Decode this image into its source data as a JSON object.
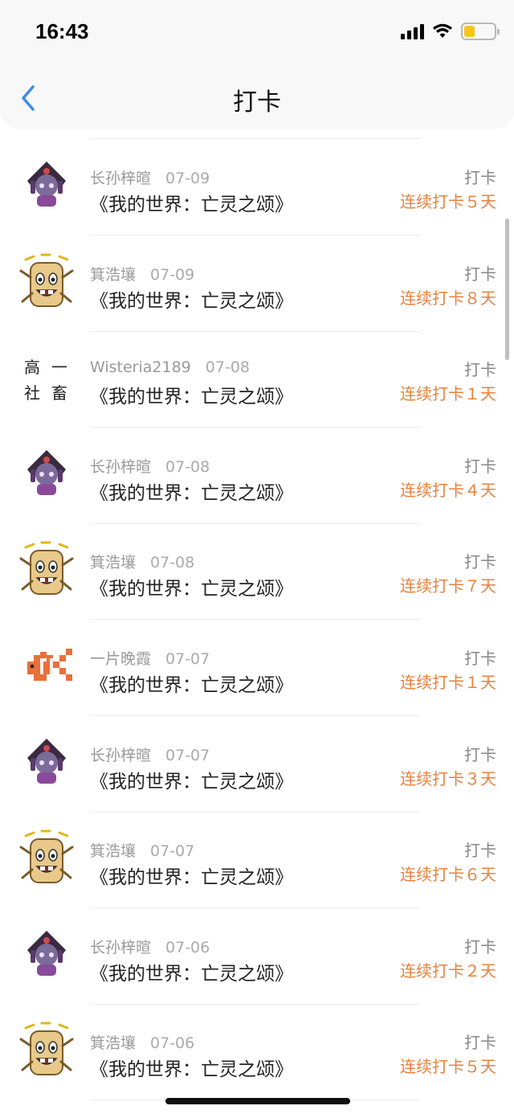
{
  "status_bar": {
    "time": "16:43",
    "battery_color": "#f5c518",
    "battery_level": 0.35
  },
  "nav": {
    "title": "打卡",
    "back_icon": "chevron-left-icon",
    "accent": "#3a8ee6"
  },
  "checkins": [
    {
      "user": "长孙梓暄",
      "date": "07-09",
      "game": "《我的世界：亡灵之颂》",
      "type": "打卡",
      "streak": "连续打卡５天",
      "avatar": "dark-hood"
    },
    {
      "user": "箕浩壤",
      "date": "07-09",
      "game": "《我的世界：亡灵之颂》",
      "type": "打卡",
      "streak": "连续打卡８天",
      "avatar": "bread"
    },
    {
      "user": "Wisteria2189",
      "date": "07-08",
      "game": "《我的世界：亡灵之颂》",
      "type": "打卡",
      "streak": "连续打卡１天",
      "avatar": "text",
      "avatar_text": [
        "高",
        "一",
        "社",
        "畜"
      ]
    },
    {
      "user": "长孙梓暄",
      "date": "07-08",
      "game": "《我的世界：亡灵之颂》",
      "type": "打卡",
      "streak": "连续打卡４天",
      "avatar": "dark-hood"
    },
    {
      "user": "箕浩壤",
      "date": "07-08",
      "game": "《我的世界：亡灵之颂》",
      "type": "打卡",
      "streak": "连续打卡７天",
      "avatar": "bread"
    },
    {
      "user": "一片晚霞",
      "date": "07-07",
      "game": "《我的世界：亡灵之颂》",
      "type": "打卡",
      "streak": "连续打卡１天",
      "avatar": "fish"
    },
    {
      "user": "长孙梓暄",
      "date": "07-07",
      "game": "《我的世界：亡灵之颂》",
      "type": "打卡",
      "streak": "连续打卡３天",
      "avatar": "dark-hood"
    },
    {
      "user": "箕浩壤",
      "date": "07-07",
      "game": "《我的世界：亡灵之颂》",
      "type": "打卡",
      "streak": "连续打卡６天",
      "avatar": "bread"
    },
    {
      "user": "长孙梓暄",
      "date": "07-06",
      "game": "《我的世界：亡灵之颂》",
      "type": "打卡",
      "streak": "连续打卡２天",
      "avatar": "dark-hood"
    },
    {
      "user": "箕浩壤",
      "date": "07-06",
      "game": "《我的世界：亡灵之颂》",
      "type": "打卡",
      "streak": "连续打卡５天",
      "avatar": "bread"
    }
  ],
  "colors": {
    "streak": "#e8813d",
    "meta": "#999999",
    "divider": "#ececec"
  }
}
